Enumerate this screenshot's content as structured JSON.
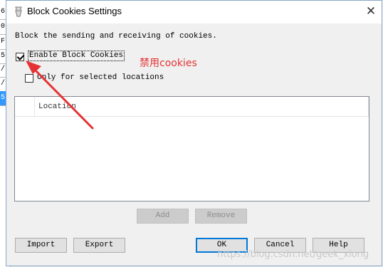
{
  "background_app": {
    "cells": [
      "6.",
      "0",
      "F",
      "5.",
      "/",
      "/",
      "5"
    ]
  },
  "window": {
    "title": "Block Cookies Settings",
    "close_glyph": "✕"
  },
  "description": "Block the sending and receiving of cookies.",
  "enable_block": {
    "label": "Enable Block Cookies",
    "checked": true
  },
  "only_selected": {
    "label": "Only for selected locations",
    "checked": false
  },
  "annotation": {
    "text": "禁用cookies",
    "color": "#e53333"
  },
  "table": {
    "columns": [
      "Location"
    ],
    "rows": []
  },
  "buttons": {
    "add": "Add",
    "remove": "Remove",
    "import": "Import",
    "export": "Export",
    "ok": "OK",
    "cancel": "Cancel",
    "help": "Help"
  },
  "watermark": "https://blog.csdn.net/geek_xiong"
}
